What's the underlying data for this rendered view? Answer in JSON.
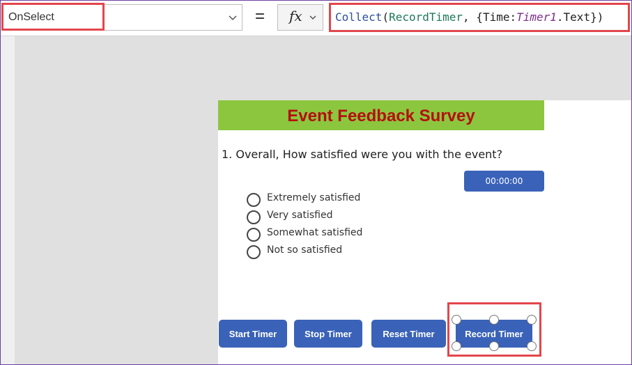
{
  "formula_bar": {
    "property": "OnSelect",
    "equals": "=",
    "fx": "fx",
    "formula": {
      "fn": "Collect",
      "open": "(",
      "collection": "RecordTimer",
      "mid": ", {Time:",
      "control": "Timer1",
      "tail": ".Text})"
    }
  },
  "screen": {
    "title": "Event Feedback Survey",
    "question": "1. Overall, How satisfied were you with the event?",
    "timer_value": "00:00:00",
    "options": [
      "Extremely satisfied",
      "Very satisfied",
      "Somewhat satisfied",
      "Not so satisfied"
    ],
    "buttons": {
      "start": "Start Timer",
      "stop": "Stop Timer",
      "reset": "Reset Timer",
      "record": "Record Timer"
    }
  },
  "colors": {
    "banner": "#8cc63f",
    "title_text": "#b50f0f",
    "button": "#3a62b8",
    "highlight": "#e2464b"
  },
  "icons": [
    "chevron-down-icon",
    "fx-icon",
    "radio-icon"
  ]
}
